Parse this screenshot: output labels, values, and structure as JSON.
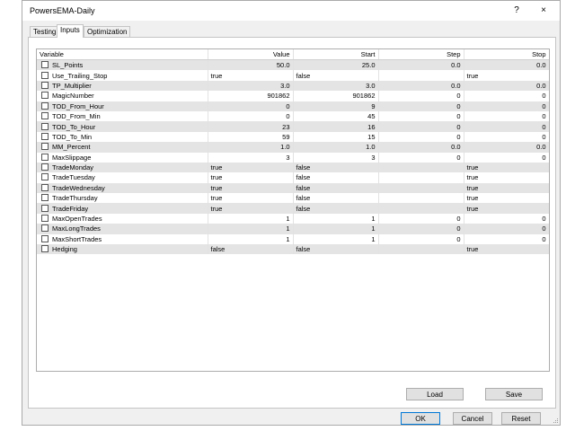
{
  "window": {
    "title": "PowersEMA-Daily",
    "help_label": "?",
    "close_label": "×"
  },
  "tabs": [
    {
      "label": "Testing"
    },
    {
      "label": "Inputs"
    },
    {
      "label": "Optimization"
    }
  ],
  "table": {
    "headers": {
      "variable": "Variable",
      "value": "Value",
      "start": "Start",
      "step": "Step",
      "stop": "Stop"
    },
    "rows": [
      {
        "variable": "SL_Points",
        "value": "50.0",
        "start": "25.0",
        "step": "0.0",
        "stop": "0.0"
      },
      {
        "variable": "Use_Trailing_Stop",
        "value": "true",
        "start": "false",
        "step": "",
        "stop": "true"
      },
      {
        "variable": "TP_Multiplier",
        "value": "3.0",
        "start": "3.0",
        "step": "0.0",
        "stop": "0.0"
      },
      {
        "variable": "MagicNumber",
        "value": "901862",
        "start": "901862",
        "step": "0",
        "stop": "0"
      },
      {
        "variable": "TOD_From_Hour",
        "value": "0",
        "start": "9",
        "step": "0",
        "stop": "0"
      },
      {
        "variable": "TOD_From_Min",
        "value": "0",
        "start": "45",
        "step": "0",
        "stop": "0"
      },
      {
        "variable": "TOD_To_Hour",
        "value": "23",
        "start": "16",
        "step": "0",
        "stop": "0"
      },
      {
        "variable": "TOD_To_Min",
        "value": "59",
        "start": "15",
        "step": "0",
        "stop": "0"
      },
      {
        "variable": "MM_Percent",
        "value": "1.0",
        "start": "1.0",
        "step": "0.0",
        "stop": "0.0"
      },
      {
        "variable": "MaxSlippage",
        "value": "3",
        "start": "3",
        "step": "0",
        "stop": "0"
      },
      {
        "variable": "TradeMonday",
        "value": "true",
        "start": "false",
        "step": "",
        "stop": "true"
      },
      {
        "variable": "TradeTuesday",
        "value": "true",
        "start": "false",
        "step": "",
        "stop": "true"
      },
      {
        "variable": "TradeWednesday",
        "value": "true",
        "start": "false",
        "step": "",
        "stop": "true"
      },
      {
        "variable": "TradeThursday",
        "value": "true",
        "start": "false",
        "step": "",
        "stop": "true"
      },
      {
        "variable": "TradeFriday",
        "value": "true",
        "start": "false",
        "step": "",
        "stop": "true"
      },
      {
        "variable": "MaxOpenTrades",
        "value": "1",
        "start": "1",
        "step": "0",
        "stop": "0"
      },
      {
        "variable": "MaxLongTrades",
        "value": "1",
        "start": "1",
        "step": "0",
        "stop": "0"
      },
      {
        "variable": "MaxShortTrades",
        "value": "1",
        "start": "1",
        "step": "0",
        "stop": "0"
      },
      {
        "variable": "Hedging",
        "value": "false",
        "start": "false",
        "step": "",
        "stop": "true"
      }
    ]
  },
  "buttons": {
    "load": "Load",
    "save": "Save",
    "ok": "OK",
    "cancel": "Cancel",
    "reset": "Reset"
  }
}
